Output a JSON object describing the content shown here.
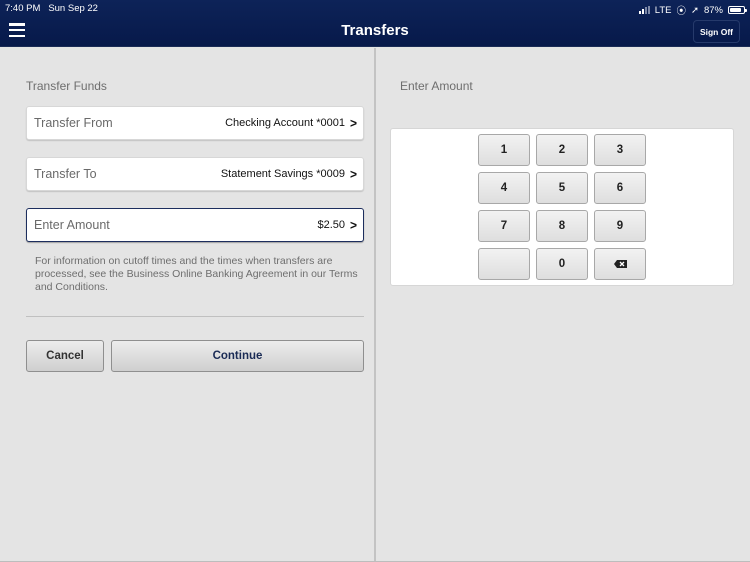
{
  "status_bar": {
    "time": "7:40 PM",
    "date": "Sun Sep 22",
    "network": "LTE",
    "battery": "87%",
    "battery_level": 0.87,
    "icons": [
      "signal-icon",
      "orientation-lock-icon",
      "location-icon",
      "battery-icon"
    ]
  },
  "header": {
    "title": "Transfers",
    "menu_icon": "hamburger-menu-icon",
    "sign_off_label": "Sign Off"
  },
  "left_panel": {
    "section_title": "Transfer Funds",
    "fields": [
      {
        "label": "Transfer From",
        "value": "Checking Account *0001",
        "icon": "chevron-right-icon"
      },
      {
        "label": "Transfer To",
        "value": "Statement Savings *0009",
        "icon": "chevron-right-icon"
      },
      {
        "label": "Enter Amount",
        "value": "$2.50",
        "icon": "chevron-right-icon",
        "active": true
      }
    ],
    "info_text": "For information on cutoff times and the times when transfers are processed, see the Business Online Banking Agreement in our Terms and Conditions.",
    "cancel_label": "Cancel",
    "continue_label": "Continue"
  },
  "right_panel": {
    "title": "Enter Amount",
    "keys": [
      "1",
      "2",
      "3",
      "4",
      "5",
      "6",
      "7",
      "8",
      "9",
      "",
      "0",
      "backspace-icon"
    ]
  }
}
